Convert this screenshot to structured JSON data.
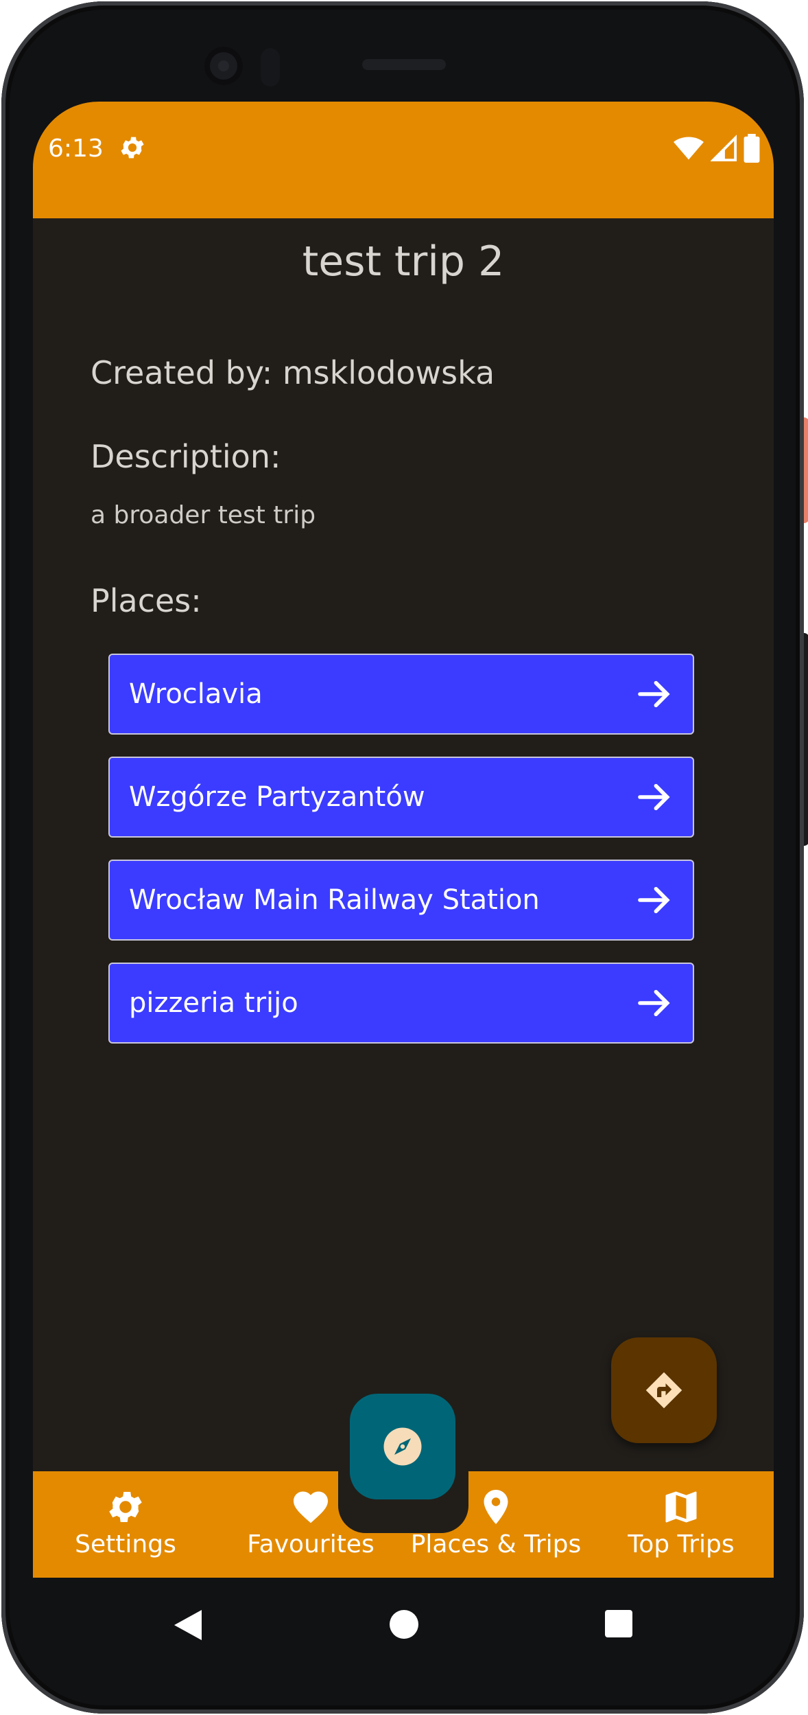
{
  "status_bar": {
    "time": "6:13",
    "color": "#e48a00"
  },
  "page": {
    "title": "test trip 2",
    "created_by": "Created by: msklodowska",
    "description_heading": "Description:",
    "description": "a broader test trip",
    "places_heading": "Places:"
  },
  "places": [
    {
      "name": "Wroclavia",
      "icon": "arrow-right-icon"
    },
    {
      "name": "Wzgórze Partyzantów",
      "icon": "arrow-right-icon"
    },
    {
      "name": "Wrocław Main Railway Station",
      "icon": "arrow-right-icon"
    },
    {
      "name": "pizzeria trijo",
      "icon": "arrow-right-icon"
    }
  ],
  "fab": {
    "route_icon": "directions-icon",
    "compass_icon": "compass-icon"
  },
  "bottom_nav": [
    {
      "label": "Settings",
      "icon": "gear-icon"
    },
    {
      "label": "Favourites",
      "icon": "heart-icon"
    },
    {
      "label": "Places & Trips",
      "icon": "location-pin-icon"
    },
    {
      "label": "Top Trips",
      "icon": "map-icon"
    }
  ],
  "colors": {
    "accent": "#e48a00",
    "background": "#211e1a",
    "place_button": "#3b3cff",
    "fab_route": "#5b3400",
    "fab_compass": "#006677"
  }
}
